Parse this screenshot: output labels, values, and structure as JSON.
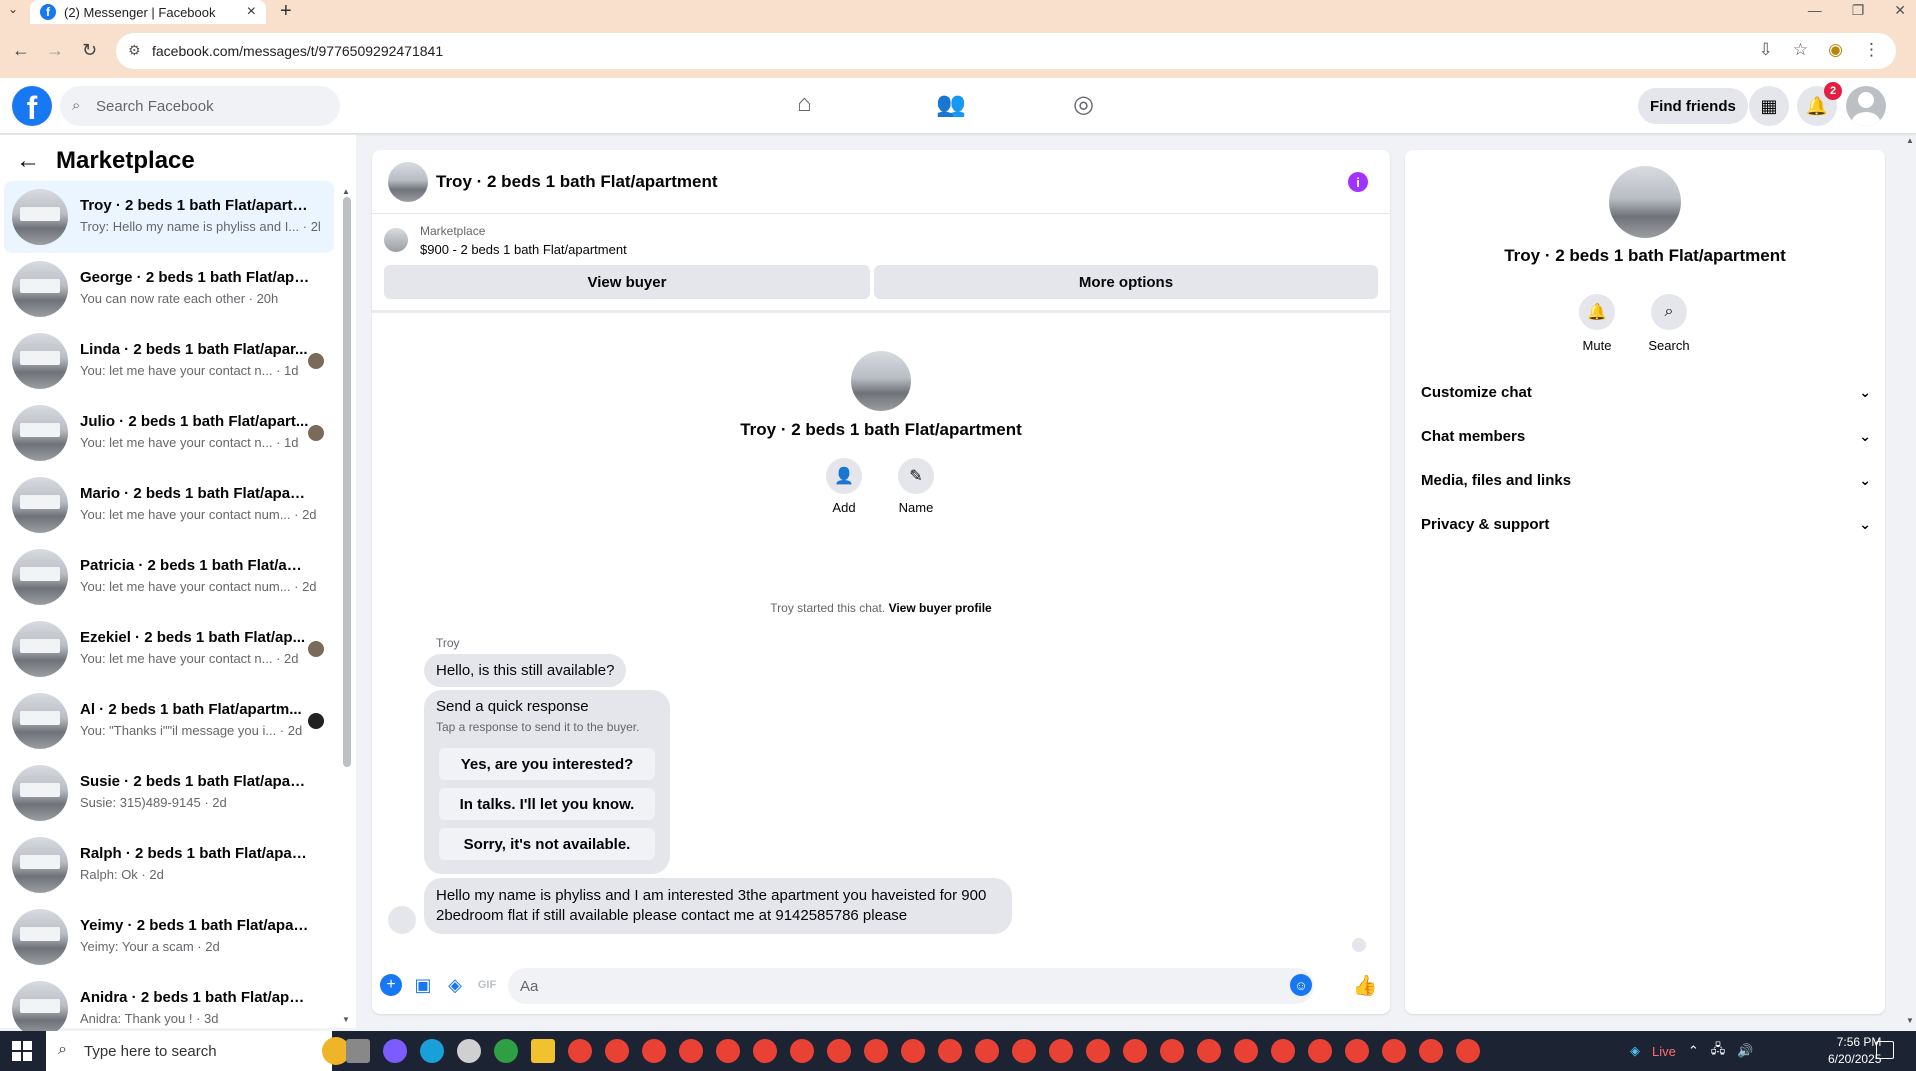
{
  "browser": {
    "tab_title": "(2) Messenger | Facebook",
    "url": "facebook.com/messages/t/9776509292471841"
  },
  "header": {
    "search_placeholder": "Search Facebook",
    "find_friends": "Find friends",
    "notif_count": "2"
  },
  "sidebar": {
    "title": "Marketplace",
    "conversations": [
      {
        "name": "Troy · 2 beds 1 bath Flat/apartm...",
        "last": "Troy: Hello my name is phyliss and I... · 2h"
      },
      {
        "name": "George · 2 beds 1 bath Flat/apar...",
        "last": "You can now rate each other · 20h"
      },
      {
        "name": "Linda · 2 beds 1 bath Flat/apar...",
        "last": "You: let me have your contact n... · 1d"
      },
      {
        "name": "Julio · 2 beds 1 bath Flat/apart...",
        "last": "You: let me have your contact n... · 1d"
      },
      {
        "name": "Mario · 2 beds 1 bath Flat/apart...",
        "last": "You: let me have your contact num... · 2d"
      },
      {
        "name": "Patricia · 2 beds 1 bath Flat/apar...",
        "last": "You: let me have your contact num... · 2d"
      },
      {
        "name": "Ezekiel · 2 beds 1 bath Flat/ap...",
        "last": "You: let me have your contact n... · 2d"
      },
      {
        "name": "Al · 2 beds 1 bath Flat/apartm...",
        "last": "You: \"Thanks i\"\"il message you i... · 2d"
      },
      {
        "name": "Susie · 2 beds 1 bath Flat/apart...",
        "last": "Susie: 315)489-9145 · 2d"
      },
      {
        "name": "Ralph · 2 beds 1 bath Flat/apart...",
        "last": "Ralph: Ok · 2d"
      },
      {
        "name": "Yeimy · 2 beds 1 bath Flat/apart...",
        "last": "Yeimy: Your a scam · 2d"
      },
      {
        "name": "Anidra · 2 beds 1 bath Flat/apart...",
        "last": "Anidra: Thank you ! · 3d"
      }
    ]
  },
  "chat": {
    "title": "Troy · 2 beds 1 bath Flat/apartment",
    "marketplace_label": "Marketplace",
    "listing": "$900 - 2 beds 1 bath Flat/apartment",
    "view_buyer": "View buyer",
    "more_options": "More options",
    "intro_name": "Troy · 2 beds 1 bath Flat/apartment",
    "add_label": "Add",
    "name_label": "Name",
    "started_text": "Troy started this chat.",
    "view_buyer_profile": "View buyer profile",
    "sender": "Troy",
    "msg1": "Hello, is this still available?",
    "quick_title": "Send a quick response",
    "quick_sub": "Tap a response to send it to the buyer.",
    "quick_options": [
      "Yes, are you interested?",
      "In talks. I'll let you know.",
      "Sorry, it's not available."
    ],
    "msg2": "Hello my name is phyliss and I am interested 3the apartment  you haveisted for 900 2bedroom flat if still available  please contact me at 9142585786 please",
    "composer_placeholder": "Aa"
  },
  "rpanel": {
    "name": "Troy · 2 beds 1 bath Flat/apartment",
    "mute": "Mute",
    "search": "Search",
    "sections": [
      "Customize chat",
      "Chat members",
      "Media, files and links",
      "Privacy & support"
    ]
  },
  "taskbar": {
    "search_placeholder": "Type here to search",
    "live": "Live",
    "time": "7:56 PM",
    "date": "6/20/2025"
  },
  "colors": {
    "brand": "#1877f2",
    "active_conv": "#ebf5ff",
    "info_icon": "#a033ff"
  }
}
